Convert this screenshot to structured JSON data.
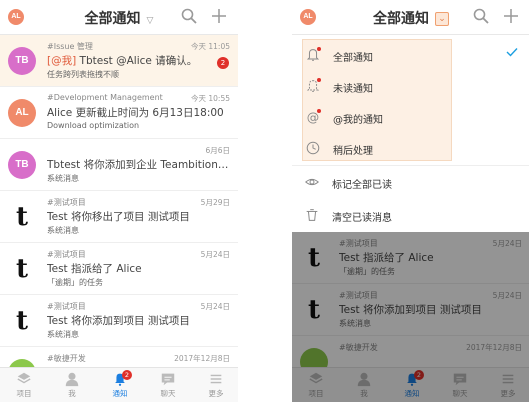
{
  "header": {
    "avatar": "AL",
    "title": "全部通知",
    "search_icon": "search-icon",
    "add_icon": "plus-icon"
  },
  "notifications": [
    {
      "avatar": "TB",
      "avatar_type": "tb",
      "category": "#Issue 管理",
      "time": "今天 11:05",
      "tag": "[@我]",
      "text": " Tbtest @Alice 请确认。",
      "sub": "任务跨列表拖拽不顺",
      "badge": "2",
      "highlight": true
    },
    {
      "avatar": "AL",
      "avatar_type": "al",
      "category": "#Development Management",
      "time": "今天 10:55",
      "tag": "",
      "text": "Alice 更新截止时间为 6月13日18:00",
      "sub": "Download optimization",
      "badge": "",
      "highlight": false
    },
    {
      "avatar": "TB",
      "avatar_type": "tb",
      "category": "",
      "time": "6月6日",
      "tag": "",
      "text": "Tbtest 将你添加到企业 Teambition…",
      "sub": "系统消息",
      "badge": "",
      "highlight": false
    },
    {
      "avatar": "t",
      "avatar_type": "t",
      "category": "#测试项目",
      "time": "5月29日",
      "tag": "",
      "text": "Test 将你移出了项目 测试项目",
      "sub": "系统消息",
      "badge": "",
      "highlight": false
    },
    {
      "avatar": "t",
      "avatar_type": "t",
      "category": "#测试项目",
      "time": "5月24日",
      "tag": "",
      "text": "Test 指派给了 Alice",
      "sub": "「逾期」的任务",
      "badge": "",
      "highlight": false
    },
    {
      "avatar": "t",
      "avatar_type": "t",
      "category": "#测试项目",
      "time": "5月24日",
      "tag": "",
      "text": "Test 将你添加到项目 测试项目",
      "sub": "系统消息",
      "badge": "",
      "highlight": false
    },
    {
      "avatar": "",
      "avatar_type": "al",
      "category": "#敏捷开发",
      "time": "2017年12月8日",
      "tag": "",
      "text": "",
      "sub": "",
      "badge": "",
      "highlight": false
    }
  ],
  "right_notifications": [
    {
      "avatar": "t",
      "category": "#测试项目",
      "time": "5月24日",
      "text": "Test 指派给了 Alice",
      "sub": "「逾期」的任务"
    },
    {
      "avatar": "t",
      "category": "#测试项目",
      "time": "5月24日",
      "text": "Test 将你添加到项目 测试项目",
      "sub": "系统消息"
    },
    {
      "avatar": "",
      "category": "#敏捷开发",
      "time": "2017年12月8日",
      "text": "",
      "sub": ""
    }
  ],
  "filters": [
    {
      "label": "全部通知",
      "icon": "bell-icon",
      "dot": true,
      "checked": true
    },
    {
      "label": "未读通知",
      "icon": "bell-unread-icon",
      "dot": true,
      "checked": false
    },
    {
      "label": "@我的通知",
      "icon": "at-icon",
      "dot": true,
      "checked": false
    },
    {
      "label": "稍后处理",
      "icon": "clock-icon",
      "dot": false,
      "checked": false
    }
  ],
  "actions": [
    {
      "label": "标记全部已读",
      "icon": "eye-icon"
    },
    {
      "label": "清空已读消息",
      "icon": "trash-icon"
    }
  ],
  "tabs": [
    {
      "label": "项目",
      "icon": "layers-icon",
      "active": false,
      "badge": ""
    },
    {
      "label": "我",
      "icon": "person-icon",
      "active": false,
      "badge": ""
    },
    {
      "label": "通知",
      "icon": "bell-icon",
      "active": true,
      "badge": "2"
    },
    {
      "label": "聊天",
      "icon": "chat-icon",
      "active": false,
      "badge": ""
    },
    {
      "label": "更多",
      "icon": "menu-icon",
      "active": false,
      "badge": ""
    }
  ],
  "colors": {
    "accent": "#1c7fe0",
    "badge": "#e0302a",
    "highlight": "#fdf4e8",
    "tag": "#e05a3a"
  }
}
